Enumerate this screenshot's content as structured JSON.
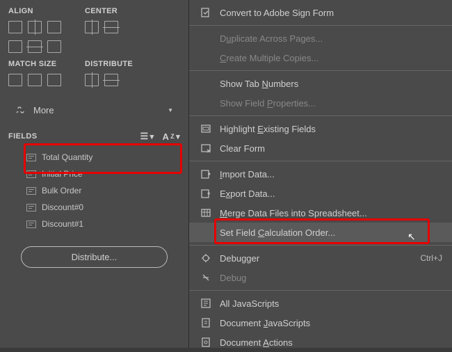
{
  "left": {
    "sections": {
      "align": "ALIGN",
      "center": "CENTER",
      "matchSize": "MATCH SIZE",
      "distribute": "DISTRIBUTE"
    },
    "more": "More",
    "fieldsHeader": "FIELDS",
    "fields": [
      "Total Quantity",
      "Initial Price",
      "Bulk Order",
      "Discount#0",
      "Discount#1"
    ],
    "distributeBtn": "Distribute..."
  },
  "menu": {
    "items": [
      {
        "label": "Convert to Adobe Sign Form",
        "disabled": false,
        "icon": "convert"
      },
      {
        "label": "Duplicate Across Pages...",
        "disabled": true,
        "ul": "u"
      },
      {
        "label": "Create Multiple Copies...",
        "disabled": true,
        "ul": "C"
      },
      {
        "label": "Show Tab Numbers",
        "disabled": false,
        "ul": "N"
      },
      {
        "label": "Show Field Properties...",
        "disabled": true,
        "ul": "P"
      },
      {
        "label": "Highlight Existing Fields",
        "disabled": false,
        "icon": "highlight",
        "ul": "E"
      },
      {
        "label": "Clear Form",
        "disabled": false,
        "icon": "clear"
      },
      {
        "label": "Import Data...",
        "disabled": false,
        "icon": "import",
        "ul": "I"
      },
      {
        "label": "Export Data...",
        "disabled": false,
        "icon": "export",
        "ul": "x"
      },
      {
        "label": "Merge Data Files into Spreadsheet...",
        "disabled": false,
        "icon": "merge",
        "ul": "M"
      },
      {
        "label": "Set Field Calculation Order...",
        "disabled": false,
        "hover": true,
        "ul": "C"
      },
      {
        "label": "Debugger",
        "disabled": false,
        "icon": "debugger",
        "shortcut": "Ctrl+J"
      },
      {
        "label": "Debug",
        "disabled": true,
        "icon": "debug"
      },
      {
        "label": "All JavaScripts",
        "disabled": false,
        "icon": "js"
      },
      {
        "label": "Document JavaScripts",
        "disabled": false,
        "icon": "docjs",
        "ul": "J"
      },
      {
        "label": "Document Actions",
        "disabled": false,
        "icon": "actions",
        "ul": "A"
      }
    ]
  }
}
